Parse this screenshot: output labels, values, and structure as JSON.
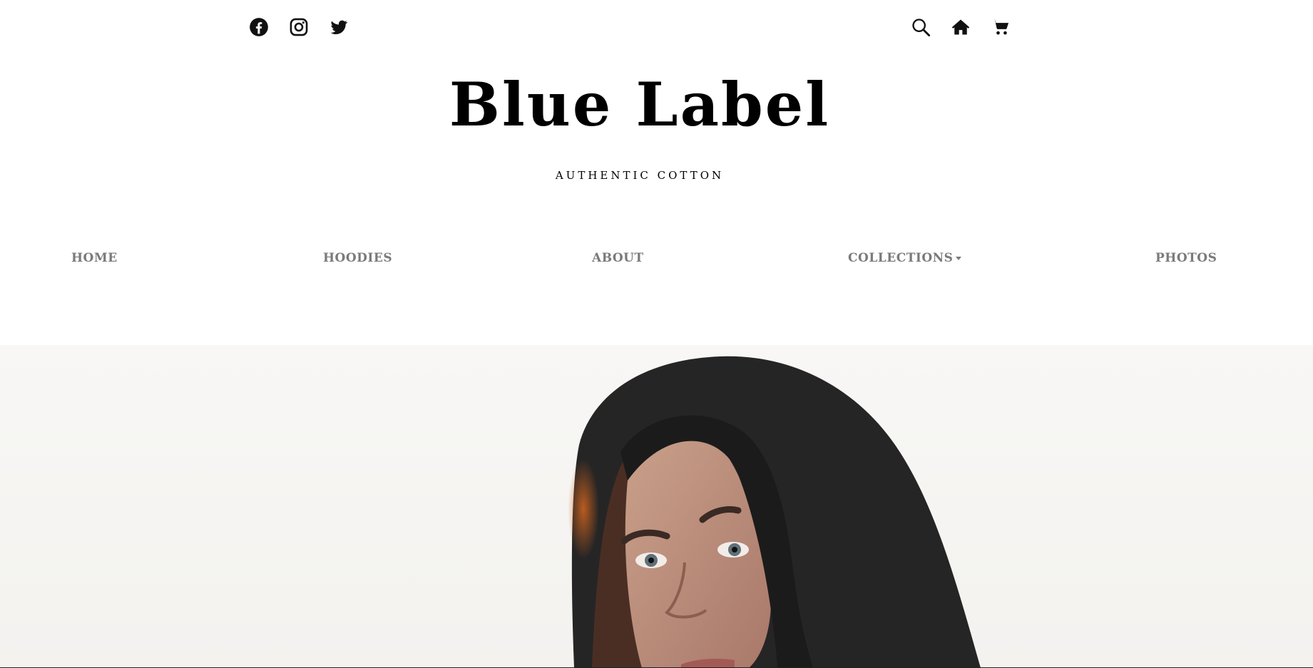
{
  "brand": {
    "name": "Blue Label",
    "tagline": "AUTHENTIC COTTON"
  },
  "social": [
    {
      "icon": "facebook-icon"
    },
    {
      "icon": "instagram-icon"
    },
    {
      "icon": "twitter-icon"
    }
  ],
  "utility": [
    {
      "icon": "search-icon"
    },
    {
      "icon": "home-icon"
    },
    {
      "icon": "cart-icon"
    }
  ],
  "nav": {
    "items": [
      "HOME",
      "HOODIES",
      "ABOUT",
      "COLLECTIONS",
      "PHOTOS"
    ]
  },
  "colors": {
    "background": "#ffffff",
    "nav_text": "#7a7a7a",
    "logo_text": "#000000"
  }
}
